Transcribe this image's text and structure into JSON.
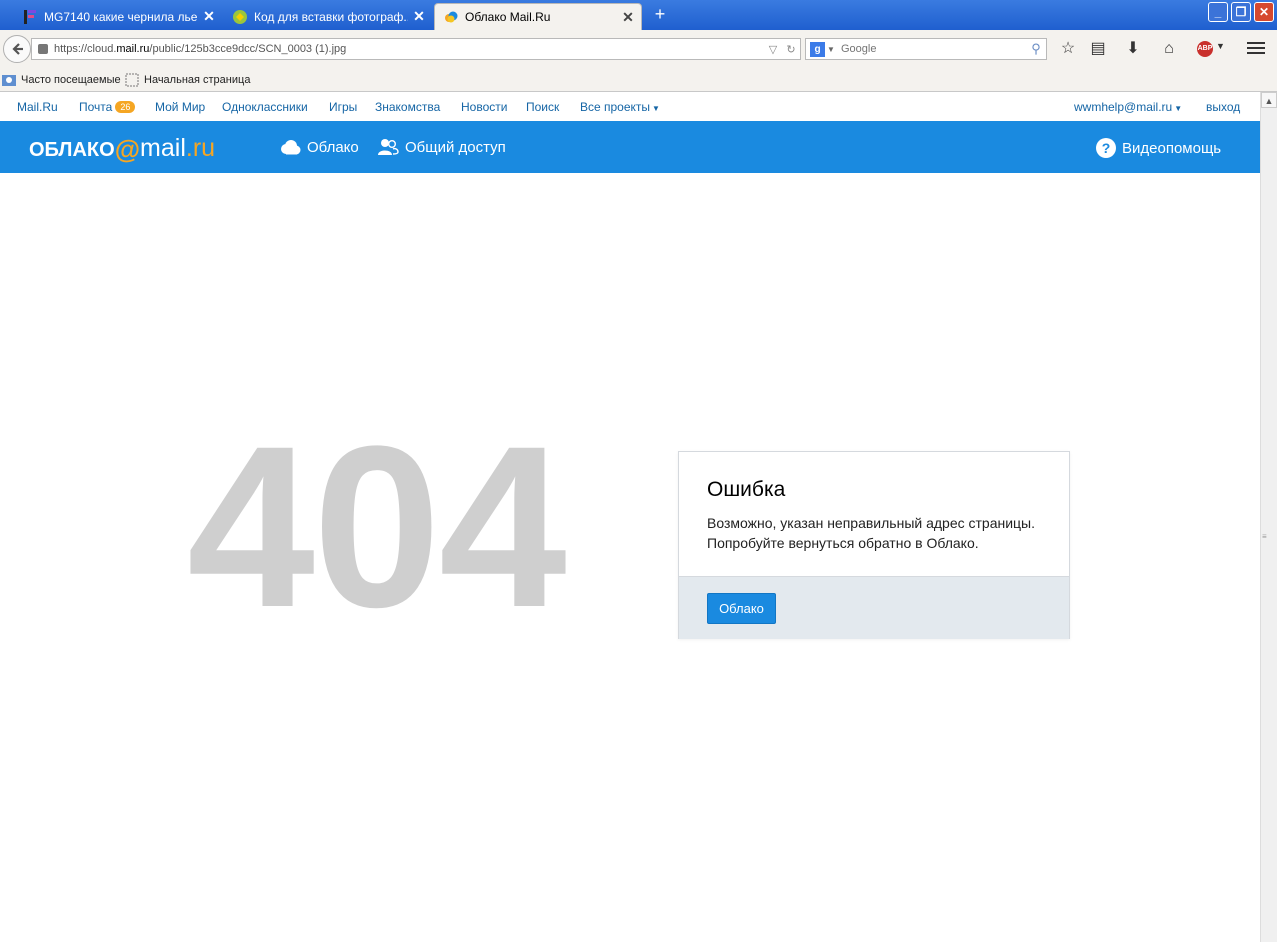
{
  "browser": {
    "tabs": [
      {
        "label": "MG7140 какие чернила лье...",
        "close": "✕"
      },
      {
        "label": "Код для вставки фотограф...",
        "close": "✕"
      },
      {
        "label": "Облако Mail.Ru",
        "close": "✕"
      }
    ],
    "new_tab": "+",
    "window_buttons": {
      "minimize": "_",
      "maximize": "❐",
      "close": "✕"
    },
    "url_prefix": "https://cloud.",
    "url_domain": "mail.ru",
    "url_path": "/public/125b3cce9dcc/SCN_0003 (1).jpg",
    "search_placeholder": "Google",
    "abp_label": "ABP",
    "bookmarks": [
      {
        "label": "Часто посещаемые"
      },
      {
        "label": "Начальная страница"
      }
    ]
  },
  "portal": {
    "links": [
      {
        "label": "Mail.Ru"
      },
      {
        "label": "Почта"
      },
      {
        "label": "Мой Мир"
      },
      {
        "label": "Одноклассники"
      },
      {
        "label": "Игры"
      },
      {
        "label": "Знакомства"
      },
      {
        "label": "Новости"
      },
      {
        "label": "Поиск"
      },
      {
        "label": "Все проекты"
      }
    ],
    "mail_badge": "26",
    "user_email": "wwmhelp@mail.ru",
    "logout": "выход"
  },
  "cloud_header": {
    "logo_prefix": "ОБЛАКО",
    "logo_at": "@",
    "logo_mail": "mail",
    "logo_ru": ".ru",
    "nav": [
      {
        "label": "Облако"
      },
      {
        "label": "Общий доступ"
      }
    ],
    "help": "Видеопомощь"
  },
  "error_page": {
    "code": "404",
    "title": "Ошибка",
    "line1": "Возможно, указан неправильный адрес страницы.",
    "line2": "Попробуйте вернуться обратно в Облако.",
    "button": "Облако"
  },
  "colors": {
    "accent": "#1a8ae0",
    "badge": "#f5a623",
    "link": "#1565a5",
    "code_gray": "#cfcfcf",
    "dialog_footer": "#e3e9ee"
  }
}
